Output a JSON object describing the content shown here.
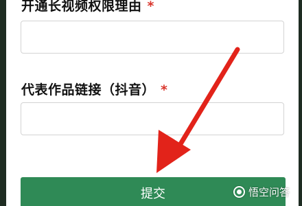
{
  "form": {
    "field1": {
      "label": "开通长视频权限理由",
      "required_mark": "*",
      "value": "",
      "placeholder": ""
    },
    "field2": {
      "label": "代表作品链接（抖音）",
      "required_mark": "*",
      "value": "",
      "placeholder": ""
    },
    "submit_label": "提交"
  },
  "annotation": {
    "arrow_color": "#e2231a",
    "icon": "red-arrow-icon"
  },
  "watermark": {
    "text": "悟空问答",
    "icon": "wukong-logo-icon"
  },
  "colors": {
    "submit_bg": "#2f8a56",
    "required": "#d9342b",
    "frame_bg": "#1e2c22"
  }
}
